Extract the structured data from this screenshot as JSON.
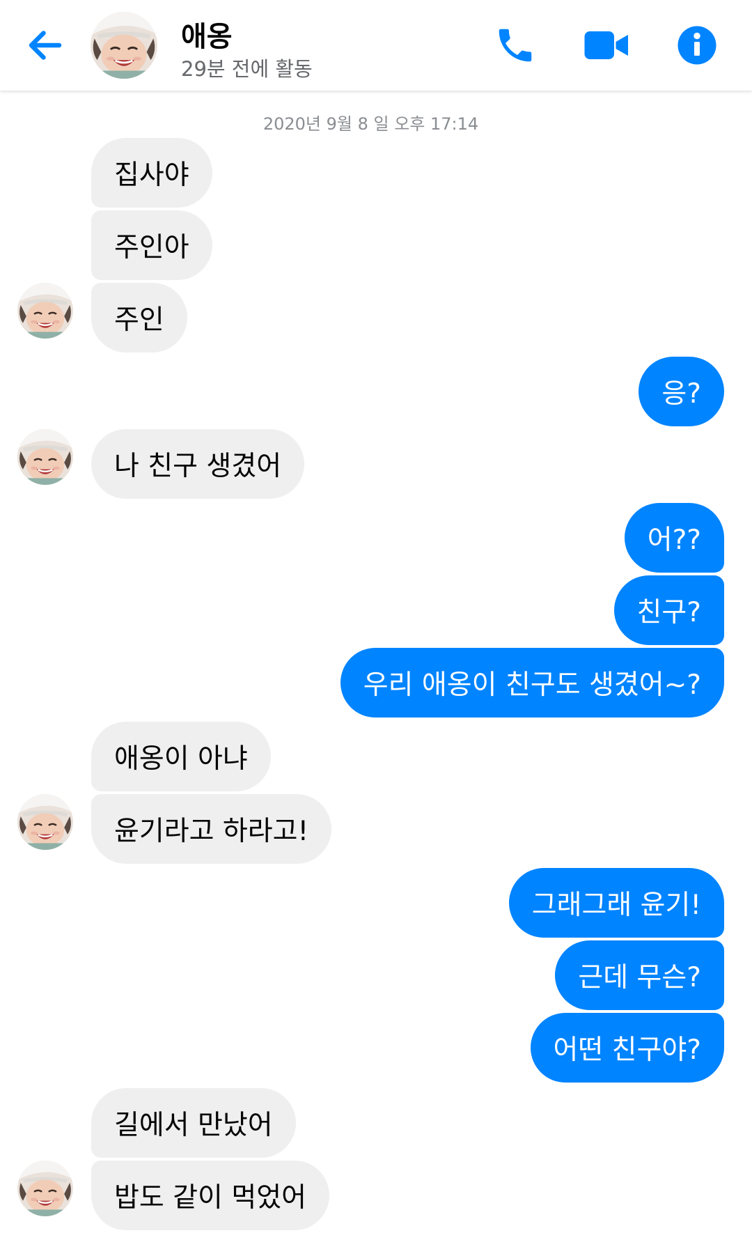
{
  "header": {
    "back_icon": "arrow-left-icon",
    "contact_name": "애옹",
    "status": "29분 전에 활동",
    "call_icon": "phone-icon",
    "video_icon": "video-camera-icon",
    "info_icon": "info-icon",
    "accent_color": "#0084ff"
  },
  "timestamp": "2020년 9월 8 일 오후 17:14",
  "messages": [
    {
      "from": "them",
      "text": "집사야"
    },
    {
      "from": "them",
      "text": "주인아"
    },
    {
      "from": "them",
      "text": "주인"
    },
    {
      "from": "me",
      "text": "응?"
    },
    {
      "from": "them",
      "text": "나 친구 생겼어"
    },
    {
      "from": "me",
      "text": "어??"
    },
    {
      "from": "me",
      "text": "친구?"
    },
    {
      "from": "me",
      "text": "우리 애옹이 친구도 생겼어~?"
    },
    {
      "from": "them",
      "text": "애옹이 아냐"
    },
    {
      "from": "them",
      "text": "윤기라고 하라고!"
    },
    {
      "from": "me",
      "text": "그래그래 윤기!"
    },
    {
      "from": "me",
      "text": "근데 무슨?"
    },
    {
      "from": "me",
      "text": "어떤 친구야?"
    },
    {
      "from": "them",
      "text": "길에서 만났어"
    },
    {
      "from": "them",
      "text": "밥도 같이 먹었어"
    }
  ],
  "colors": {
    "outgoing_bubble": "#0084ff",
    "incoming_bubble": "#efefef"
  }
}
